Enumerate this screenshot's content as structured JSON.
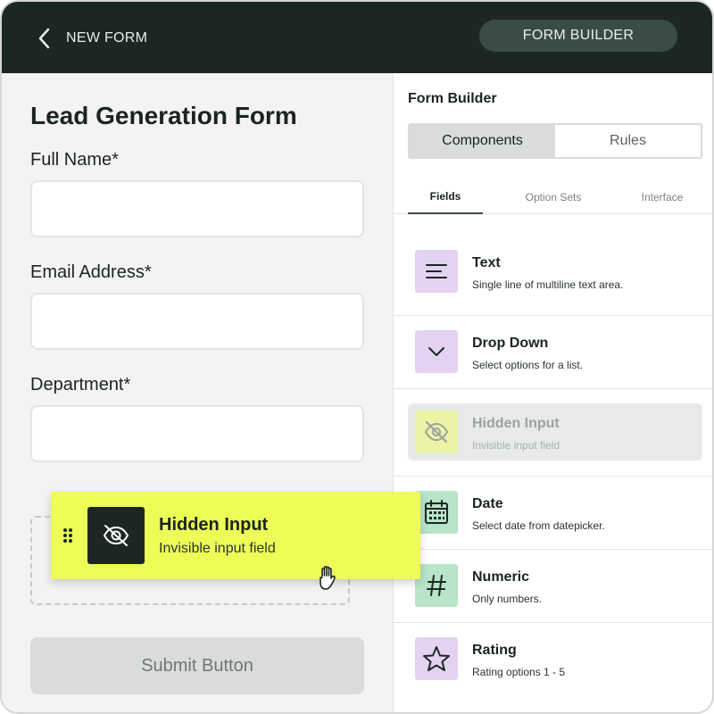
{
  "header": {
    "back_label": "NEW FORM",
    "mode_label": "FORM BUILDER",
    "back_icon": "chevron-left-icon"
  },
  "form": {
    "title": "Lead Generation Form",
    "fields": [
      {
        "label": "Full Name*",
        "value": ""
      },
      {
        "label": "Email Address*",
        "value": ""
      },
      {
        "label": "Department*",
        "value": ""
      }
    ],
    "submit_label": "Submit Button"
  },
  "panel": {
    "title": "Form Builder",
    "segments": [
      {
        "label": "Components",
        "active": true
      },
      {
        "label": "Rules",
        "active": false
      }
    ],
    "tabs": [
      {
        "label": "Fields",
        "active": true
      },
      {
        "label": "Option Sets",
        "active": false
      },
      {
        "label": "Interface",
        "active": false
      }
    ],
    "components": [
      {
        "name": "Text",
        "desc": "Single line of multiline text area.",
        "icon": "text-lines-icon",
        "color": "#e3d3f1"
      },
      {
        "name": "Drop Down",
        "desc": "Select options for a list.",
        "icon": "chevron-down-icon",
        "color": "#e3d3f1"
      },
      {
        "name": "Hidden Input",
        "desc": "Invisible input field",
        "icon": "eye-off-icon",
        "color": "#ebf3a6",
        "state": "dragging-placeholder"
      },
      {
        "name": "Date",
        "desc": "Select date from datepicker.",
        "icon": "calendar-icon",
        "color": "#b8e4c8"
      },
      {
        "name": "Numeric",
        "desc": "Only numbers.",
        "icon": "hash-icon",
        "color": "#b8e4c8"
      },
      {
        "name": "Rating",
        "desc": "Rating options 1 - 5",
        "icon": "star-icon",
        "color": "#e3d3f1"
      }
    ]
  },
  "drag": {
    "name": "Hidden Input",
    "desc": "Invisible input field",
    "icon": "eye-off-icon",
    "color": "#eefc57"
  }
}
